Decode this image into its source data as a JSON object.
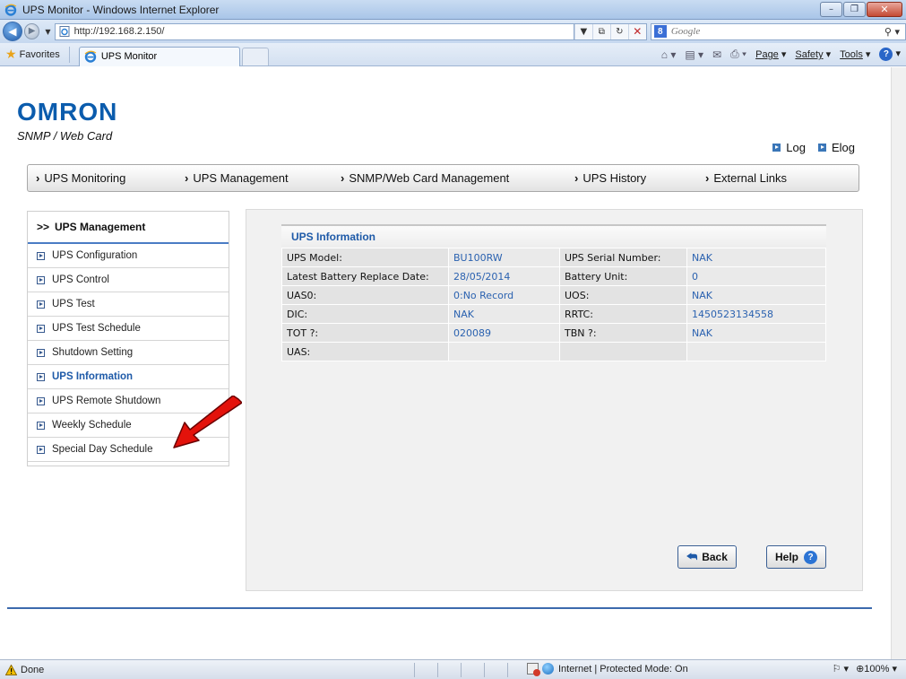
{
  "window": {
    "title": "UPS Monitor - Windows Internet Explorer",
    "minimize": "–",
    "maximize": "❐",
    "close": "✕"
  },
  "address": {
    "url": "http://192.168.2.150/",
    "search_placeholder": "Google"
  },
  "favorites": {
    "label": "Favorites",
    "tab_title": "UPS Monitor"
  },
  "command_bar": {
    "page": "Page",
    "safety": "Safety",
    "tools": "Tools"
  },
  "header": {
    "logo": "OMRON",
    "subtitle": "SNMP / Web Card",
    "links": [
      "Log",
      "Elog"
    ]
  },
  "main_nav": [
    "UPS Monitoring",
    "UPS Management",
    "SNMP/Web Card Management",
    "UPS History",
    "External Links"
  ],
  "sidebar": {
    "heading": "UPS Management",
    "items": [
      {
        "label": "UPS Configuration"
      },
      {
        "label": "UPS Control"
      },
      {
        "label": "UPS Test"
      },
      {
        "label": "UPS Test Schedule"
      },
      {
        "label": "Shutdown Setting"
      },
      {
        "label": "UPS Information"
      },
      {
        "label": "UPS Remote Shutdown"
      },
      {
        "label": "Weekly Schedule"
      },
      {
        "label": "Special Day Schedule"
      }
    ],
    "active_index": 5
  },
  "info": {
    "title": "UPS Information",
    "rows": [
      [
        "UPS Model:",
        "BU100RW",
        "UPS Serial Number:",
        "NAK"
      ],
      [
        "Latest Battery Replace Date:",
        "28/05/2014",
        "Battery Unit:",
        "0"
      ],
      [
        "UAS0:",
        "0:No Record",
        "UOS:",
        "NAK"
      ],
      [
        "DIC:",
        "NAK",
        "RRTC:",
        "1450523134558"
      ],
      [
        "TOT ?:",
        "020089",
        "TBN ?:",
        "NAK"
      ],
      [
        "UAS:",
        "",
        "",
        ""
      ]
    ]
  },
  "buttons": {
    "back": "Back",
    "help": "Help"
  },
  "status": {
    "left": "Done",
    "zone": "Internet | Protected Mode: On",
    "zoom": "100%"
  },
  "colors": {
    "accent": "#1e5aa8",
    "logo": "#0b5cad",
    "arrow": "#e3120b"
  }
}
